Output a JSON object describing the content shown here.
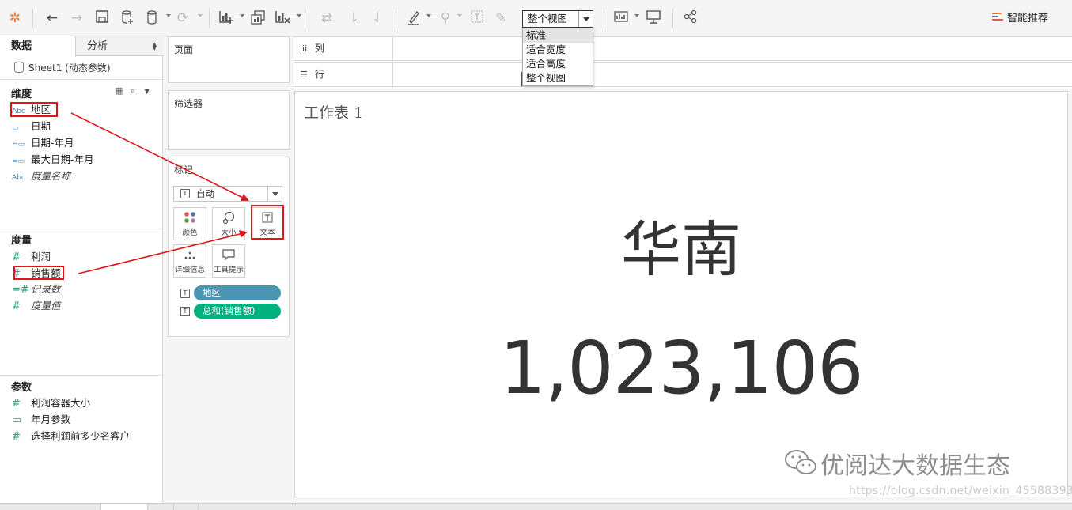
{
  "toolbar": {
    "fit_value": "整个视图",
    "smart_label": "智能推荐"
  },
  "fit_dropdown": {
    "options": [
      "标准",
      "适合宽度",
      "适合高度",
      "整个视图"
    ]
  },
  "data_pane": {
    "tabs": [
      "数据",
      "分析"
    ],
    "datasource": "Sheet1 (动态参数)",
    "dimensions": {
      "header": "维度",
      "items": [
        {
          "icon": "Abc",
          "label": "地区"
        },
        {
          "icon": "calendar",
          "label": "日期"
        },
        {
          "icon": "calendar-derived",
          "label": "日期-年月"
        },
        {
          "icon": "calendar-calc",
          "label": "最大日期-年月"
        },
        {
          "icon": "Abc",
          "label": "度量名称"
        }
      ]
    },
    "measures": {
      "header": "度量",
      "items": [
        {
          "icon": "#",
          "label": "利润"
        },
        {
          "icon": "#",
          "label": "销售额"
        },
        {
          "icon": "=#",
          "label": "记录数"
        },
        {
          "icon": "#",
          "label": "度量值"
        }
      ]
    },
    "parameters": {
      "header": "参数",
      "items": [
        {
          "icon": "#",
          "label": "利润容器大小"
        },
        {
          "icon": "calendar",
          "label": "年月参数"
        },
        {
          "icon": "#",
          "label": "选择利润前多少名客户"
        }
      ]
    }
  },
  "shelves": {
    "pages": "页面",
    "filters": "筛选器",
    "marks": "标记",
    "mark_type": "自动",
    "mark_buttons": [
      "颜色",
      "大小",
      "文本",
      "详细信息",
      "工具提示"
    ],
    "mark_pills": [
      {
        "label": "地区",
        "color": "#4996b2"
      },
      {
        "label": "总和(销售额)",
        "color": "#00b180"
      }
    ],
    "columns": "列",
    "rows": "行"
  },
  "sheet": {
    "title": "工作表 1",
    "region": "华南",
    "value": "1,023,106"
  },
  "watermark": {
    "text": "优阅达大数据生态",
    "url": "https://blog.csdn.net/weixin_45588393"
  },
  "colors": {
    "annotation_red": "#e0141b",
    "dimension_blue": "#4996b2",
    "measure_green": "#00b180"
  }
}
